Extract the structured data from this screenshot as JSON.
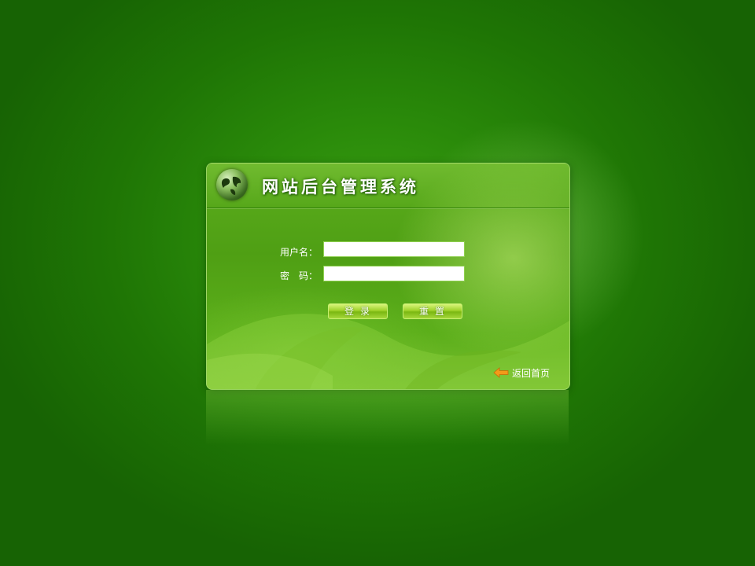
{
  "app": {
    "title": "网站后台管理系统"
  },
  "form": {
    "username_label": "用户名：",
    "password_label": "密　码：",
    "username_value": "",
    "password_value": ""
  },
  "buttons": {
    "login_label": "登录",
    "reset_label": "重置"
  },
  "footer": {
    "back_home_label": "返回首页"
  },
  "icons": {
    "logo": "globe-icon",
    "back": "arrow-left-icon"
  },
  "colors": {
    "background": "#2a8a0a",
    "panel": "#5cae1e",
    "button": "#9fd22a",
    "arrow": "#f39a1a"
  }
}
